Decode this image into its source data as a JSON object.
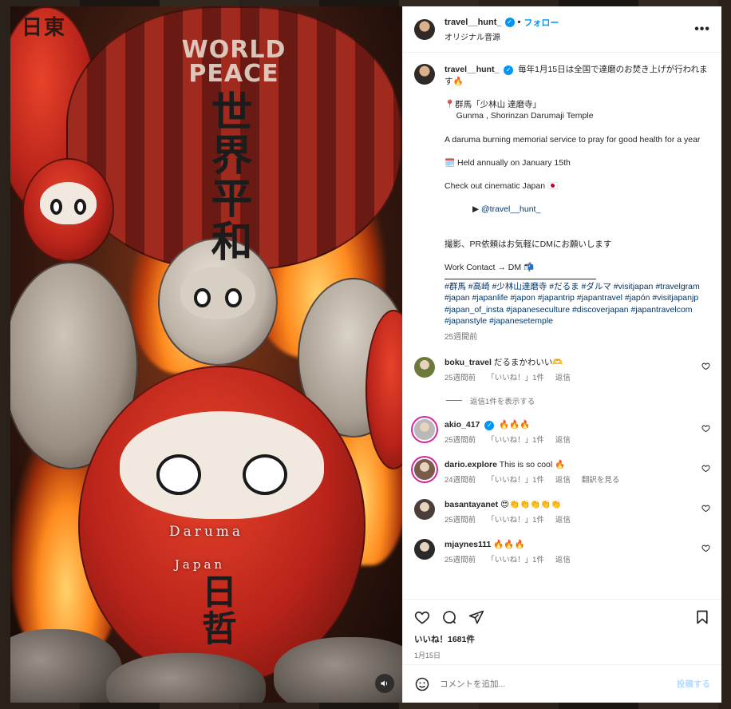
{
  "header": {
    "username": "travel__hunt_",
    "follow_label": "フォロー",
    "audio_label": "オリジナル音源",
    "more_label": "•••"
  },
  "media": {
    "overlay_line1": "Daruma",
    "overlay_line2": "Japan",
    "sign_text": "WORLD PEACE",
    "kanji_large": "世界平和",
    "kanji_left": "日東",
    "kanji_bottom": "日哲"
  },
  "caption": {
    "username": "travel__hunt_",
    "lines": [
      "毎年1月15日は全国で達磨のお焚き上げが行われます🔥",
      "",
      "📍群馬「少林山 達磨寺」",
      "     Gunma , Shorinzan Darumaji Temple",
      "",
      "A daruma burning memorial service to pray for good health for a year",
      "",
      "🗓️ Held annually on January 15th",
      "",
      "Check out cinematic Japan 🇯🇵"
    ],
    "mention_prefix": "▶ ",
    "mention": "@travel__hunt_",
    "lines_after": [
      "撮影、PR依頼はお気軽にDMにお願いします",
      "",
      "Work Contact → DM 📬"
    ],
    "hashtags": "#群馬 #高崎 #少林山達磨寺 #だるま #ダルマ #visitjapan #travelgram #japan #japanlife #japon #japantrip #japantravel #japón #visitjapanjp #japan_of_insta #japaneseculture #discoverjapan #japantravelcom #japanstyle #japanesetemple",
    "time": "25週間前"
  },
  "comments": [
    {
      "user": "boku_travel",
      "text": "だるまかわいい🫶",
      "time": "25週間前",
      "likes": "「いいね！」1件",
      "reply": "返信",
      "extra": "",
      "avatar_color": "#6b7a3a",
      "verified": false,
      "ring": false
    },
    {
      "user": "akio_417",
      "text": "🔥🔥🔥",
      "time": "25週間前",
      "likes": "「いいね！」1件",
      "reply": "返信",
      "extra": "",
      "avatar_color": "#b9b9b9",
      "verified": true,
      "ring": true
    },
    {
      "user": "dario.explore",
      "text": "This is so cool 🔥",
      "time": "24週間前",
      "likes": "「いいね！」1件",
      "reply": "返信",
      "extra": "翻訳を見る",
      "avatar_color": "#7a5a48",
      "verified": false,
      "ring": true
    },
    {
      "user": "basantayanet",
      "text": "😍👏👏👏👏👏",
      "time": "25週間前",
      "likes": "「いいね！」1件",
      "reply": "返信",
      "extra": "",
      "avatar_color": "#4a3d3a",
      "verified": false,
      "ring": false
    },
    {
      "user": "mjaynes111",
      "text": "🔥🔥🔥",
      "time": "25週間前",
      "likes": "「いいね！」1件",
      "reply": "返信",
      "extra": "",
      "avatar_color": "#2a2a2a",
      "verified": false,
      "ring": false
    }
  ],
  "view_replies_label": "返信1件を表示する",
  "actions": {
    "likes_text": "いいね！1681件",
    "date": "1月15日"
  },
  "composer": {
    "placeholder": "コメントを追加...",
    "post_label": "投稿する"
  },
  "colors": {
    "accent": "#0095f6",
    "hashtag": "#00376b",
    "muted": "#737373"
  }
}
